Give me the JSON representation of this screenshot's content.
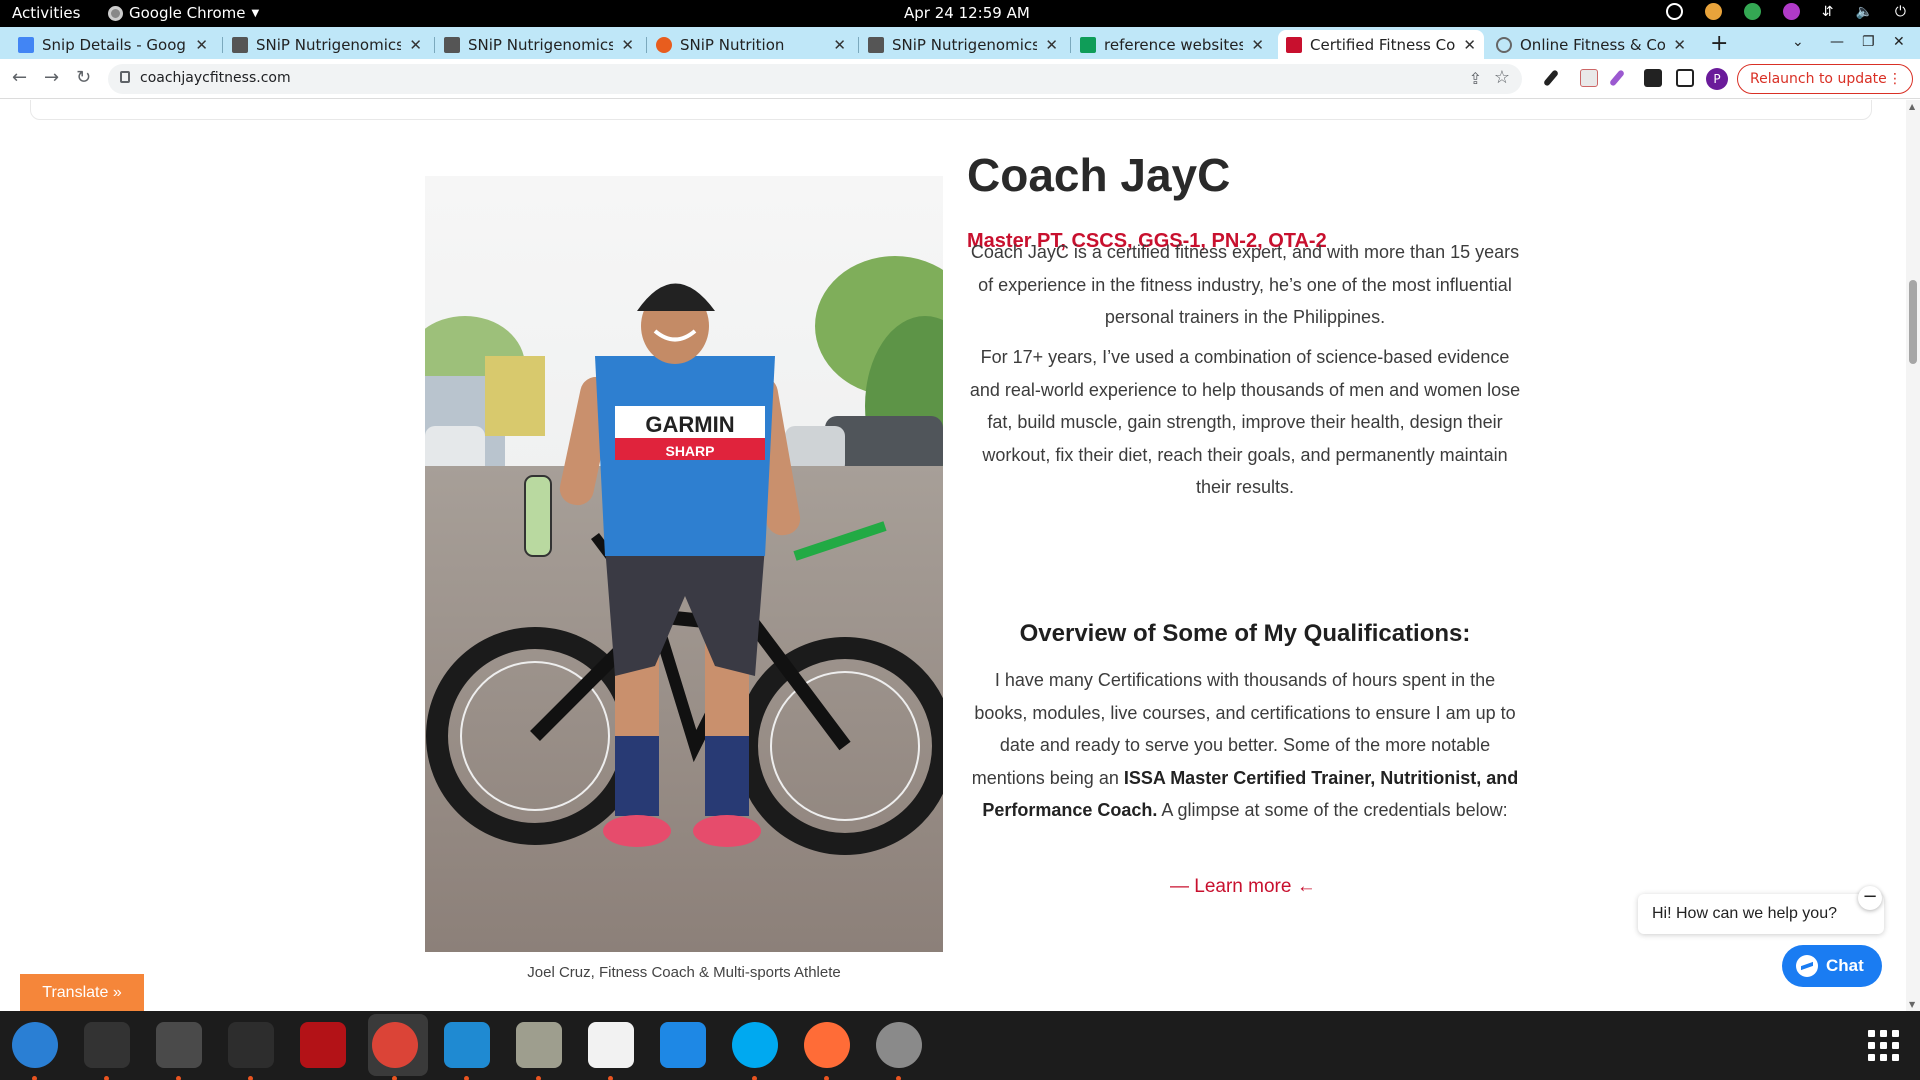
{
  "topbar": {
    "activities": "Activities",
    "app_name": "Google Chrome",
    "clock": "Apr 24  12:59 AM"
  },
  "tabs": [
    {
      "title": "Snip Details - Google",
      "favicon": "docs-icon",
      "color": "#4285f4"
    },
    {
      "title": "SNiP Nutrigenomics A",
      "favicon": "snip-icon",
      "color": "#555555"
    },
    {
      "title": "SNiP Nutrigenomics A",
      "favicon": "snip-icon",
      "color": "#555555"
    },
    {
      "title": "SNiP Nutrition",
      "favicon": "snip-nutrition-icon",
      "color": "#e85d1e"
    },
    {
      "title": "SNiP Nutrigenomics A",
      "favicon": "snip-icon",
      "color": "#555555"
    },
    {
      "title": "reference websites - G",
      "favicon": "sheets-icon",
      "color": "#0f9d58"
    },
    {
      "title": "Certified Fitness Coac",
      "favicon": "coachjayc-icon",
      "color": "#c8102e",
      "active": true
    },
    {
      "title": "Online Fitness & Coac",
      "favicon": "globe-icon",
      "color": "#666666"
    }
  ],
  "toolbar": {
    "url": "coachjaycfitness.com",
    "profile_initial": "P",
    "relaunch_label": "Relaunch to update",
    "relaunch_dots": "⋮"
  },
  "page": {
    "name": "Coach JayC",
    "credentials": "Master PT, CSCS, GGS-1, PN-2, OTA-2",
    "intro": "Coach JayC is a certified fitness expert, and with more than 15 years of experience in the fitness industry, he’s one of the most influential personal trainers in the Philippines.",
    "experience": "For 17+ years, I’ve used a combination of science-based evidence and real-world experience to help thousands of men and women lose fat, build muscle, gain strength, improve their health, design their workout, fix their diet, reach their goals, and permanently maintain their results.",
    "qual_heading": "Overview of Some of My Qualifications:",
    "qual_text_1": "I have many Certifications with thousands of hours spent in the books, modules, live courses, and certifications to ensure I am up to date and ready to serve you better. Some of the more notable mentions being an ",
    "qual_bold": "ISSA Master Certified Trainer, Nutritionist, and Performance Coach.",
    "qual_text_2": " A glimpse at some of the credentials below:",
    "learn_more": "— Learn more  ←",
    "photo_caption": "Joel Cruz, Fitness Coach & Multi-sports Athlete",
    "jersey_text_1": "GARMIN",
    "jersey_text_2": "SHARP"
  },
  "widgets": {
    "chat_greeting": "Hi! How can we help you?",
    "chat_min": "−",
    "chat_button": "Chat",
    "translate": "Translate »"
  },
  "dock": [
    {
      "name": "thunderbird-icon",
      "color": "#2a7fd4",
      "running": true
    },
    {
      "name": "terminal-icon",
      "color": "#333333",
      "running": true
    },
    {
      "name": "calculator-icon",
      "color": "#4a4a4a",
      "running": true
    },
    {
      "name": "system-monitor-icon",
      "color": "#2d2d2d",
      "running": true
    },
    {
      "name": "filezilla-icon",
      "color": "#b31217",
      "running": false
    },
    {
      "name": "chrome-icon",
      "color": "#db4437",
      "running": true
    },
    {
      "name": "vscode-icon",
      "color": "#1f8ad2",
      "running": true
    },
    {
      "name": "files-icon",
      "color": "#9e9e8e",
      "running": true
    },
    {
      "name": "text-editor-icon",
      "color": "#f2f2f2",
      "running": true
    },
    {
      "name": "libreoffice-writer-icon",
      "color": "#1e88e5",
      "running": false
    },
    {
      "name": "skype-icon",
      "color": "#00a9f0",
      "running": true
    },
    {
      "name": "postman-icon",
      "color": "#ff6c37",
      "running": true
    },
    {
      "name": "disk-icon",
      "color": "#8a8a8a",
      "running": true
    }
  ]
}
